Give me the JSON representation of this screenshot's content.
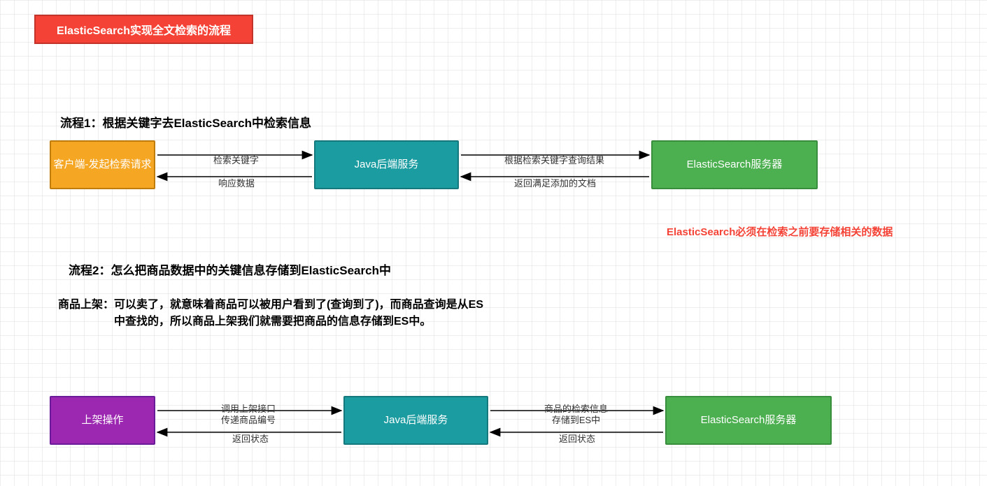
{
  "title": "ElasticSearch实现全文检索的流程",
  "flow1": {
    "heading": "流程1：根据关键字去ElasticSearch中检索信息",
    "client": "客户端-发起检索请求",
    "backend": "Java后端服务",
    "es": "ElasticSearch服务器",
    "arrow1": "检索关键字",
    "arrow2": "响应数据",
    "arrow3": "根据检索关键字查询结果",
    "arrow4": "返回满足添加的文档"
  },
  "note": "ElasticSearch必须在检索之前要存储相关的数据",
  "flow2": {
    "heading": "流程2：怎么把商品数据中的关键信息存储到ElasticSearch中",
    "subtext": "商品上架：可以卖了，就意味着商品可以被用户看到了(查询到了)，而商品查询是从ES\n　　　　　中查找的，所以商品上架我们就需要把商品的信息存储到ES中。",
    "client": "上架操作",
    "backend": "Java后端服务",
    "es": "ElasticSearch服务器",
    "arrow1": "调用上架接口\n传递商品编号",
    "arrow2": "返回状态",
    "arrow3": "商品的检索信息\n存储到ES中",
    "arrow4": "返回状态"
  }
}
